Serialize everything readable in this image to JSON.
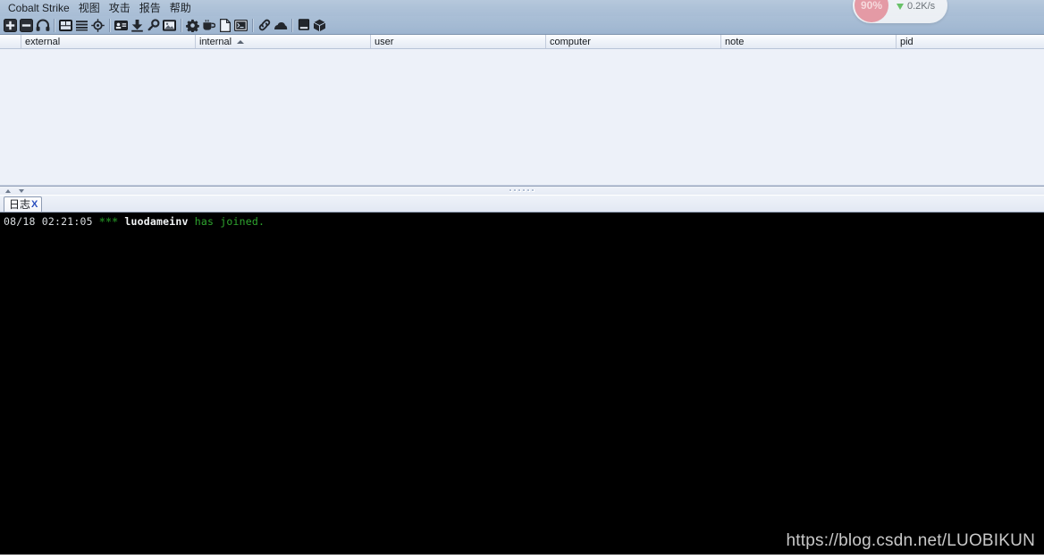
{
  "app": {
    "title": "Cobalt Strike"
  },
  "menubar": {
    "items": [
      {
        "label": "Cobalt Strike",
        "name": "menu-cobalt-strike"
      },
      {
        "label": "视图",
        "name": "menu-view"
      },
      {
        "label": "攻击",
        "name": "menu-attacks"
      },
      {
        "label": "报告",
        "name": "menu-reporting"
      },
      {
        "label": "帮助",
        "name": "menu-help"
      }
    ]
  },
  "toolbar": {
    "buttons": [
      {
        "icon": "plus-square-icon",
        "name": "new-connection-button"
      },
      {
        "icon": "minus-square-icon",
        "name": "disconnect-button"
      },
      {
        "icon": "headphones-icon",
        "name": "listeners-button"
      },
      {
        "sep": true
      },
      {
        "icon": "pivot-graph-icon",
        "name": "pivot-graph-button"
      },
      {
        "icon": "session-table-icon",
        "name": "session-table-button"
      },
      {
        "icon": "targets-icon",
        "name": "targets-button"
      },
      {
        "sep": true
      },
      {
        "icon": "credentials-icon",
        "name": "credentials-button"
      },
      {
        "icon": "downloads-icon",
        "name": "downloads-button"
      },
      {
        "icon": "keystrokes-icon",
        "name": "keystrokes-button"
      },
      {
        "icon": "screenshots-icon",
        "name": "screenshots-button"
      },
      {
        "sep": true
      },
      {
        "icon": "gear-icon",
        "name": "scripts-button"
      },
      {
        "icon": "coffee-cup-icon",
        "name": "java-applet-button"
      },
      {
        "icon": "document-icon",
        "name": "payload-file-button"
      },
      {
        "icon": "console-window-icon",
        "name": "web-drive-by-button"
      },
      {
        "sep": true
      },
      {
        "icon": "link-icon",
        "name": "host-file-button"
      },
      {
        "icon": "cloud-icon",
        "name": "manage-web-button"
      },
      {
        "sep": true
      },
      {
        "icon": "server-icon",
        "name": "server-button"
      },
      {
        "icon": "cube-icon",
        "name": "package-button"
      }
    ]
  },
  "table": {
    "columns": [
      {
        "label": "external",
        "name": "column-external",
        "width": 195,
        "sorted": ""
      },
      {
        "label": "internal",
        "name": "column-internal",
        "width": 196,
        "sorted": "asc"
      },
      {
        "label": "user",
        "name": "column-user",
        "width": 196,
        "sorted": ""
      },
      {
        "label": "computer",
        "name": "column-computer",
        "width": 196,
        "sorted": ""
      },
      {
        "label": "note",
        "name": "column-note",
        "width": 196,
        "sorted": ""
      },
      {
        "label": "pid",
        "name": "column-pid",
        "width": 165,
        "sorted": ""
      }
    ],
    "rows": []
  },
  "tabs": {
    "items": [
      {
        "label": "日志",
        "close": "X",
        "name": "tab-event-log",
        "active": true
      }
    ]
  },
  "console": {
    "lines": [
      {
        "timestamp": "08/18 02:21:05",
        "stars": "***",
        "nick": "luodameinv",
        "message": "has joined."
      }
    ]
  },
  "watermark": {
    "text": "https://blog.csdn.net/LUOBIKUN"
  },
  "speed_widget": {
    "percent": "90%",
    "rate": "0.2K/s",
    "direction": "down",
    "circle_color": "#e49aa5",
    "arrow_color": "#68c168"
  }
}
